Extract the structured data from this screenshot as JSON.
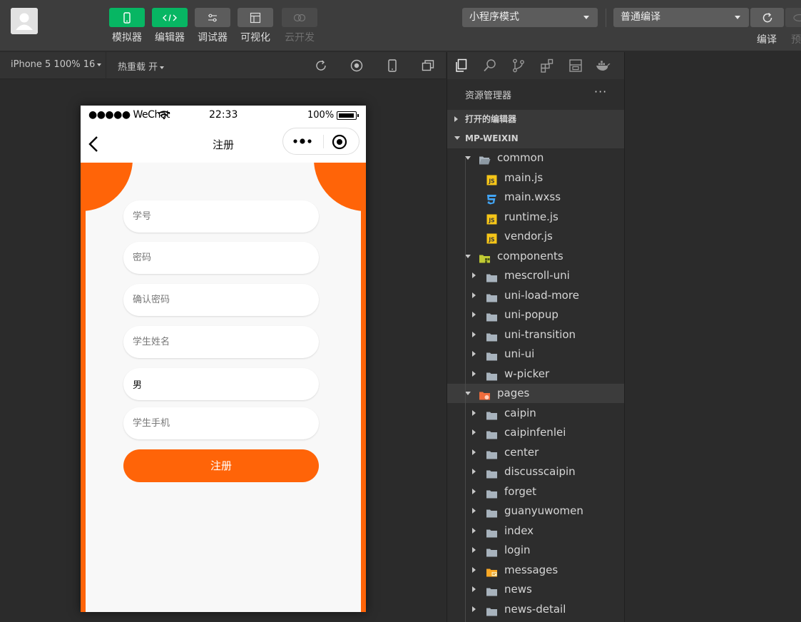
{
  "toolbar": {
    "tools": [
      {
        "label": "模拟器",
        "icon": "phone-icon",
        "state": "active"
      },
      {
        "label": "编辑器",
        "icon": "code-icon",
        "state": "active"
      },
      {
        "label": "调试器",
        "icon": "sliders-icon",
        "state": "normal"
      },
      {
        "label": "可视化",
        "icon": "layout-icon",
        "state": "normal"
      },
      {
        "label": "云开发",
        "icon": "cloud-icon",
        "state": "disabled"
      }
    ],
    "mode_select": "小程序模式",
    "compile_select": "普通编译",
    "compile_label": "编译",
    "preview_label": "预",
    "colors": {
      "active": "#07b663",
      "toolbar_bg": "#3d3d3d"
    }
  },
  "simbar": {
    "device": "iPhone 5 100% 16",
    "hot_reload": "热重载 开"
  },
  "phone": {
    "status": {
      "carrier": "●●●●● WeChat",
      "time": "22:33",
      "battery": "100%"
    },
    "nav_title": "注册",
    "fields": [
      {
        "placeholder": "学号",
        "value": ""
      },
      {
        "placeholder": "密码",
        "value": ""
      },
      {
        "placeholder": "确认密码",
        "value": ""
      },
      {
        "placeholder": "学生姓名",
        "value": ""
      },
      {
        "placeholder": "",
        "value": "男"
      },
      {
        "placeholder": "学生手机",
        "value": ""
      }
    ],
    "register_label": "注册",
    "accent": "#ff6408"
  },
  "explorer": {
    "title": "资源管理器",
    "more": "···",
    "sections": [
      {
        "label": "打开的编辑器",
        "expanded": false
      },
      {
        "label": "MP-WEIXIN",
        "expanded": true
      }
    ],
    "tree": [
      {
        "label": "common",
        "level": 1,
        "type": "folder-open",
        "expanded": true
      },
      {
        "label": "main.js",
        "level": 2,
        "type": "js"
      },
      {
        "label": "main.wxss",
        "level": 2,
        "type": "css"
      },
      {
        "label": "runtime.js",
        "level": 2,
        "type": "js"
      },
      {
        "label": "vendor.js",
        "level": 2,
        "type": "js"
      },
      {
        "label": "components",
        "level": 1,
        "type": "folder-components",
        "expanded": true
      },
      {
        "label": "mescroll-uni",
        "level": 2,
        "type": "folder",
        "expanded": false
      },
      {
        "label": "uni-load-more",
        "level": 2,
        "type": "folder",
        "expanded": false
      },
      {
        "label": "uni-popup",
        "level": 2,
        "type": "folder",
        "expanded": false
      },
      {
        "label": "uni-transition",
        "level": 2,
        "type": "folder",
        "expanded": false
      },
      {
        "label": "uni-ui",
        "level": 2,
        "type": "folder",
        "expanded": false
      },
      {
        "label": "w-picker",
        "level": 2,
        "type": "folder",
        "expanded": false
      },
      {
        "label": "pages",
        "level": 1,
        "type": "folder-pages",
        "expanded": true,
        "selected": true
      },
      {
        "label": "caipin",
        "level": 2,
        "type": "folder",
        "expanded": false
      },
      {
        "label": "caipinfenlei",
        "level": 2,
        "type": "folder",
        "expanded": false
      },
      {
        "label": "center",
        "level": 2,
        "type": "folder",
        "expanded": false
      },
      {
        "label": "discusscaipin",
        "level": 2,
        "type": "folder",
        "expanded": false
      },
      {
        "label": "forget",
        "level": 2,
        "type": "folder",
        "expanded": false
      },
      {
        "label": "guanyuwomen",
        "level": 2,
        "type": "folder",
        "expanded": false
      },
      {
        "label": "index",
        "level": 2,
        "type": "folder",
        "expanded": false
      },
      {
        "label": "login",
        "level": 2,
        "type": "folder",
        "expanded": false
      },
      {
        "label": "messages",
        "level": 2,
        "type": "folder-messages",
        "expanded": false
      },
      {
        "label": "news",
        "level": 2,
        "type": "folder",
        "expanded": false
      },
      {
        "label": "news-detail",
        "level": 2,
        "type": "folder",
        "expanded": false
      }
    ]
  }
}
